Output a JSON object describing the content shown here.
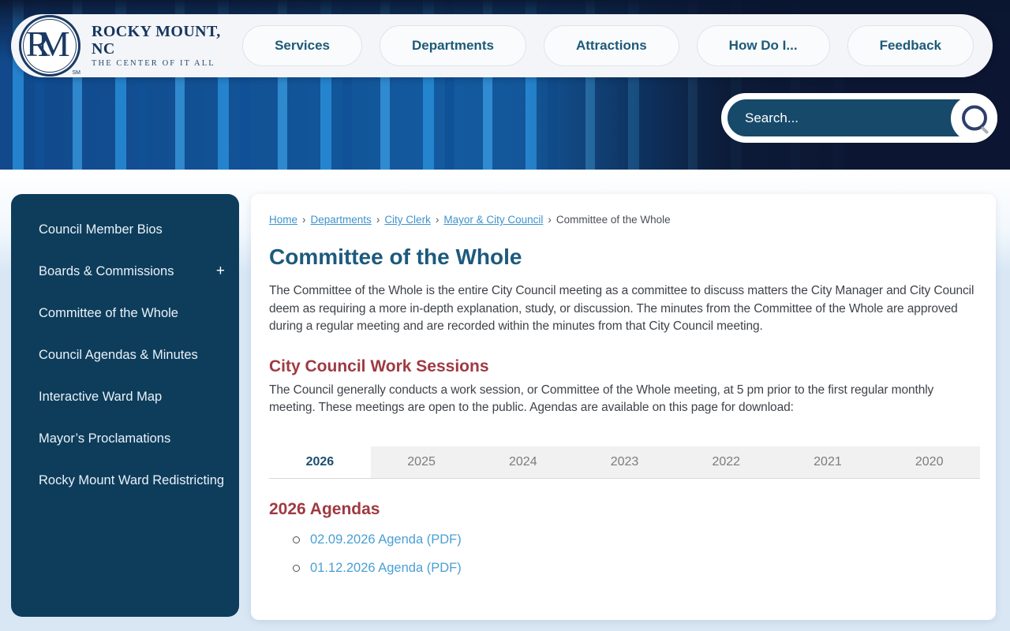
{
  "brand": {
    "monogram": "RM",
    "trademark": "SM",
    "name": "ROCKY MOUNT, NC",
    "tagline": "THE CENTER OF IT ALL"
  },
  "nav": {
    "items": [
      {
        "label": "Services"
      },
      {
        "label": "Departments"
      },
      {
        "label": "Attractions"
      },
      {
        "label": "How Do I..."
      },
      {
        "label": "Feedback"
      }
    ]
  },
  "search": {
    "placeholder": "Search..."
  },
  "sidebar": {
    "items": [
      {
        "label": "Council Member Bios"
      },
      {
        "label": "Boards & Commissions",
        "expander": "+"
      },
      {
        "label": "Committee of the Whole"
      },
      {
        "label": "Council Agendas & Minutes"
      },
      {
        "label": "Interactive Ward Map"
      },
      {
        "label": "Mayor’s Proclamations"
      },
      {
        "label": "Rocky Mount Ward Redistricting"
      }
    ]
  },
  "breadcrumb": {
    "separator": "›",
    "links": [
      {
        "label": "Home"
      },
      {
        "label": "Departments"
      },
      {
        "label": "City Clerk"
      },
      {
        "label": "Mayor & City Council"
      }
    ],
    "current": "Committee of the Whole"
  },
  "main": {
    "title": "Committee of the Whole",
    "intro": "The Committee of the Whole is the entire City Council meeting as a committee to discuss matters the City Manager and City Council deem as requiring a more in-depth explanation, study, or discussion. The minutes from the Committee of the Whole are approved during a regular meeting and are recorded within the minutes from that City Council meeting.",
    "work_sessions": {
      "heading": "City Council Work Sessions",
      "body": "The Council generally conducts a work session, or Committee of the Whole meeting, at 5 pm prior to the first regular monthly meeting. These meetings are open to the public. Agendas are available on this page for download:"
    },
    "year_tabs": {
      "active": "2026",
      "tabs": [
        "2026",
        "2025",
        "2024",
        "2023",
        "2022",
        "2021",
        "2020"
      ]
    },
    "agendas": {
      "heading": "2026 Agendas",
      "items": [
        {
          "label": "02.09.2026 Agenda (PDF)"
        },
        {
          "label": "01.12.2026 Agenda (PDF)"
        }
      ]
    }
  },
  "colors": {
    "sidebar_bg": "#0e3d5b",
    "heading_blue": "#1d5a7d",
    "accent_maroon": "#9e3a42",
    "link_blue": "#4a9fd4",
    "breadcrumb_link": "#3d93cf",
    "nav_text": "#1c5a78",
    "search_fill": "#17496a",
    "page_bg": "#d9e7f5"
  }
}
